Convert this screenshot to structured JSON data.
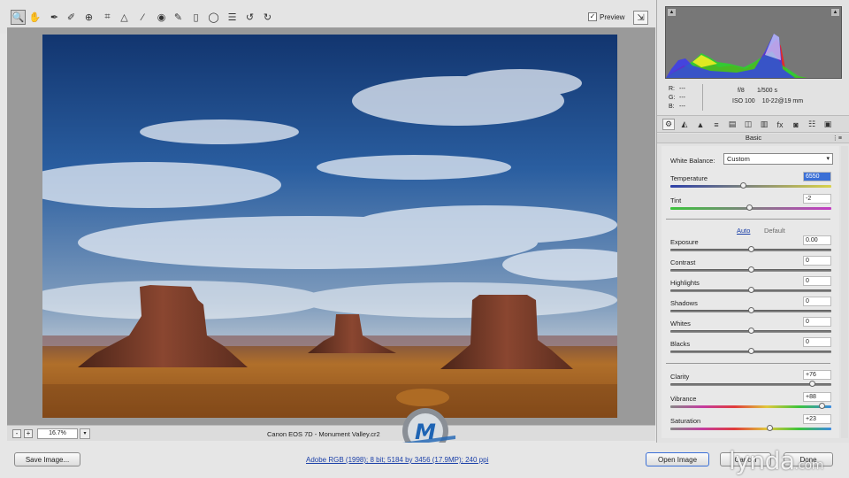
{
  "toolbar": {
    "tools": [
      {
        "name": "zoom-icon",
        "glyph": "🔍"
      },
      {
        "name": "hand-icon",
        "glyph": "✋"
      },
      {
        "name": "eyedropper-icon",
        "glyph": "✒"
      },
      {
        "name": "color-sampler-icon",
        "glyph": "✐"
      },
      {
        "name": "targeted-adjustment-icon",
        "glyph": "⊕"
      },
      {
        "name": "crop-icon",
        "glyph": "⌗"
      },
      {
        "name": "straighten-icon",
        "glyph": "△"
      },
      {
        "name": "spot-removal-icon",
        "glyph": "⁄"
      },
      {
        "name": "red-eye-icon",
        "glyph": "◉"
      },
      {
        "name": "adjustment-brush-icon",
        "glyph": "✎"
      },
      {
        "name": "graduated-filter-icon",
        "glyph": "▯"
      },
      {
        "name": "radial-filter-icon",
        "glyph": "◯"
      },
      {
        "name": "preferences-icon",
        "glyph": "☰"
      },
      {
        "name": "rotate-left-icon",
        "glyph": "↺"
      },
      {
        "name": "rotate-right-icon",
        "glyph": "↻"
      }
    ],
    "preview_label": "Preview",
    "preview_checked": "✓",
    "fullscreen_glyph": "⇲"
  },
  "status": {
    "zoom_out": "-",
    "zoom_in": "+",
    "zoom_value": "16.7%",
    "zoom_dropdown": "▾",
    "filename": "Canon EOS 7D  -  Monument Valley.cr2"
  },
  "footer": {
    "save_image": "Save Image...",
    "workflow_link": "Adobe RGB (1998); 8 bit; 5184 by 3456 (17.9MP); 240 ppi",
    "open_image": "Open Image",
    "cancel": "Cancel",
    "done": "Done",
    "brand": "lynda",
    "brand_suffix": ".com"
  },
  "panel": {
    "histogram": {
      "shadow_clip": "▲",
      "highlight_clip": "▲"
    },
    "readout": {
      "r_label": "R:",
      "r_value": "---",
      "g_label": "G:",
      "g_value": "---",
      "b_label": "B:",
      "b_value": "---",
      "aperture": "f/8",
      "shutter": "1/500 s",
      "iso": "ISO 100",
      "lens": "10-22@19 mm"
    },
    "tabs": [
      "⚙",
      "◭",
      "▲",
      "≡",
      "▤",
      "◫",
      "▥",
      "fx",
      "◙",
      "☷",
      "▣"
    ],
    "section_title": "Basic",
    "section_menu": "⋮≡",
    "white_balance_label": "White Balance:",
    "white_balance_value": "Custom",
    "white_balance_arrow": "▾",
    "auto_label": "Auto",
    "default_label": "Default",
    "sliders": {
      "temperature": {
        "label": "Temperature",
        "value": "6550",
        "level": 0.45
      },
      "tint": {
        "label": "Tint",
        "value": "-2",
        "level": 0.49
      },
      "exposure": {
        "label": "Exposure",
        "value": "0.00",
        "level": 0.5
      },
      "contrast": {
        "label": "Contrast",
        "value": "0",
        "level": 0.5
      },
      "highlights": {
        "label": "Highlights",
        "value": "0",
        "level": 0.5
      },
      "shadows": {
        "label": "Shadows",
        "value": "0",
        "level": 0.5
      },
      "whites": {
        "label": "Whites",
        "value": "0",
        "level": 0.5
      },
      "blacks": {
        "label": "Blacks",
        "value": "0",
        "level": 0.5
      },
      "clarity": {
        "label": "Clarity",
        "value": "+76",
        "level": 0.88
      },
      "vibrance": {
        "label": "Vibrance",
        "value": "+88",
        "level": 0.94
      },
      "saturation": {
        "label": "Saturation",
        "value": "+23",
        "level": 0.615
      }
    }
  },
  "colors": {
    "sky_top": "#163a7a",
    "sky_bottom": "#c9d3dc",
    "ground": "#9a5a22",
    "butte": "#6b3824",
    "link": "#1a3fa8"
  }
}
